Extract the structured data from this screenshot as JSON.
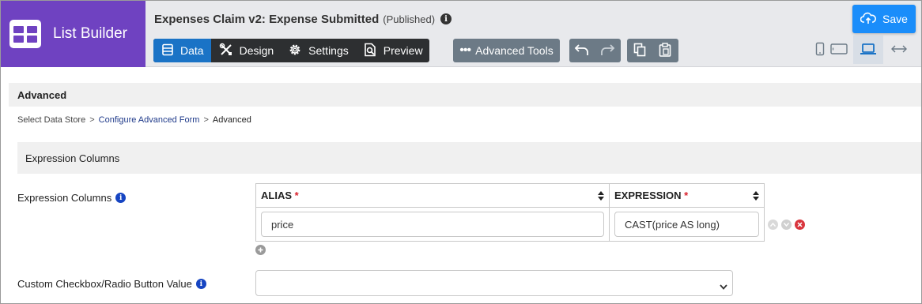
{
  "app": {
    "name": "List Builder",
    "form_title": "Expenses Claim v2: Expense Submitted",
    "form_status": "(Published)"
  },
  "toolbar": {
    "tabs": [
      {
        "label": "Data",
        "icon": "table-icon",
        "active": true
      },
      {
        "label": "Design",
        "icon": "tools-icon",
        "active": false
      },
      {
        "label": "Settings",
        "icon": "gear-icon",
        "active": false
      },
      {
        "label": "Preview",
        "icon": "preview-icon",
        "active": false
      }
    ],
    "advanced_tools_label": "Advanced Tools",
    "save_label": "Save",
    "accent_color": "#1a73c6",
    "brand_color": "#6f42c1",
    "save_color": "#1a8dfa",
    "active_device": "laptop"
  },
  "section": {
    "title": "Advanced"
  },
  "breadcrumb": {
    "items": [
      "Select Data Store",
      "Configure Advanced Form",
      "Advanced"
    ],
    "separator": ">"
  },
  "panel": {
    "title": "Expression Columns"
  },
  "fields": {
    "expression_columns_label": "Expression Columns",
    "custom_value_label": "Custom Checkbox/Radio Button Value",
    "custom_value_selected": ""
  },
  "expression_table": {
    "columns": [
      {
        "label": "ALIAS",
        "required_mark": "*"
      },
      {
        "label": "EXPRESSION",
        "required_mark": "*"
      }
    ],
    "rows": [
      {
        "alias": "price",
        "expression": "CAST(price AS long)"
      }
    ]
  }
}
